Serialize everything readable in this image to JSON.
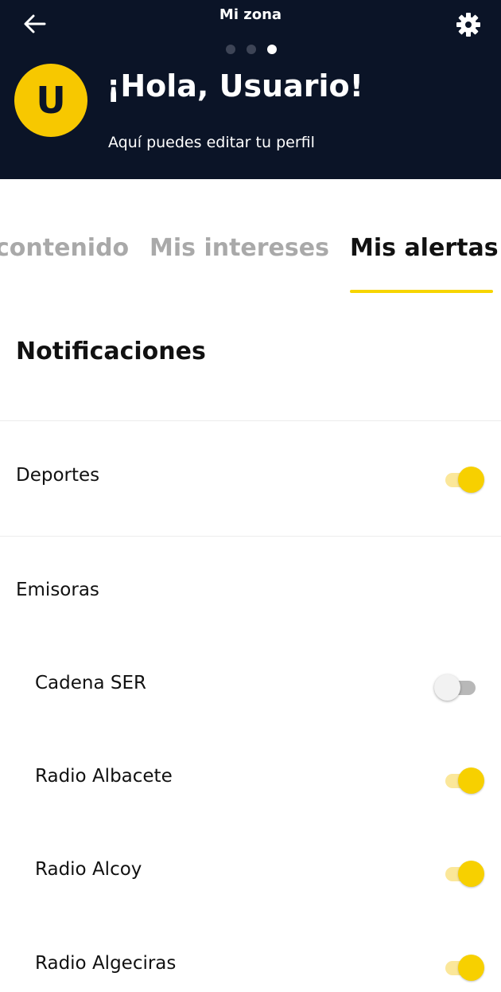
{
  "header": {
    "title": "Mi zona",
    "back_icon": "arrow-left-icon",
    "settings_icon": "gear-icon",
    "pager_count": 3,
    "pager_active_index": 2,
    "avatar_initial": "U",
    "greeting": "¡Hola, Usuario!",
    "subtitle": "Aquí puedes editar tu perfil"
  },
  "tabs": [
    {
      "label": "contenido",
      "active": false
    },
    {
      "label": "Mis intereses",
      "active": false
    },
    {
      "label": "Mis alertas",
      "active": true
    }
  ],
  "notifications": {
    "title": "Notificaciones",
    "deportes": {
      "label": "Deportes",
      "enabled": true
    },
    "emisoras_label": "Emisoras",
    "emisoras": [
      {
        "label": "Cadena SER",
        "enabled": false
      },
      {
        "label": "Radio Albacete",
        "enabled": true
      },
      {
        "label": "Radio Alcoy",
        "enabled": true
      },
      {
        "label": "Radio Algeciras",
        "enabled": true
      }
    ]
  },
  "colors": {
    "header_bg": "#0b1427",
    "accent": "#f7d000",
    "tab_inactive": "#a9a9a9"
  }
}
